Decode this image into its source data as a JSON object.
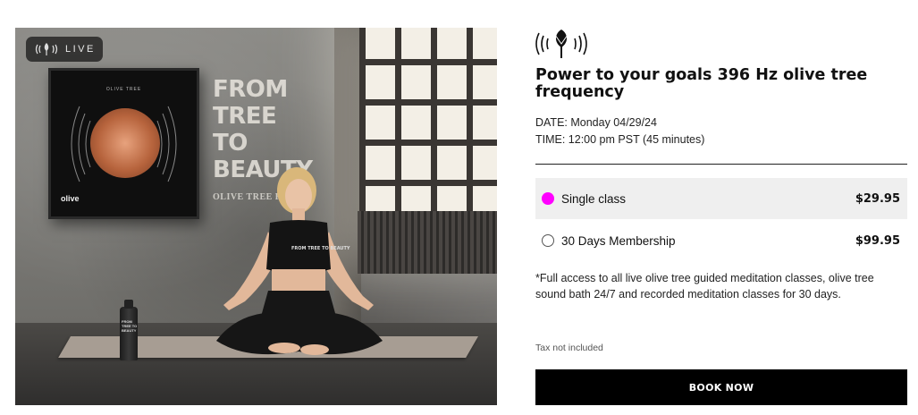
{
  "hero": {
    "live_badge": "LIVE",
    "wall_text": [
      "FROM",
      "TREE",
      "TO",
      "BEAUTY"
    ],
    "wall_subtext": "OLIVE TREE PF",
    "frame_brand": "olive",
    "frame_title": "OLIVE TREE",
    "bottle_text": "FROM TREE TO BEAUTY",
    "shirt_text": "FROM TREE TO BEAUTY"
  },
  "product": {
    "logo_icon": "tree-sound-waves-logo",
    "title": "Power to your goals 396 Hz olive tree frequency",
    "date": "DATE: Monday 04/29/24",
    "time": "TIME: 12:00 pm PST (45 minutes)"
  },
  "options": [
    {
      "label": "Single class",
      "price": "$29.95",
      "selected": true
    },
    {
      "label": "30 Days Membership",
      "price": "$99.95",
      "selected": false
    }
  ],
  "note": "*Full access to all live olive tree guided meditation classes, olive tree sound bath 24/7 and recorded meditation classes for 30 days.",
  "tax_note": "Tax not included",
  "cta": {
    "label": "BOOK NOW"
  },
  "colors": {
    "accent": "#ff00ff",
    "button_bg": "#000000",
    "selected_row_bg": "#efefef"
  }
}
